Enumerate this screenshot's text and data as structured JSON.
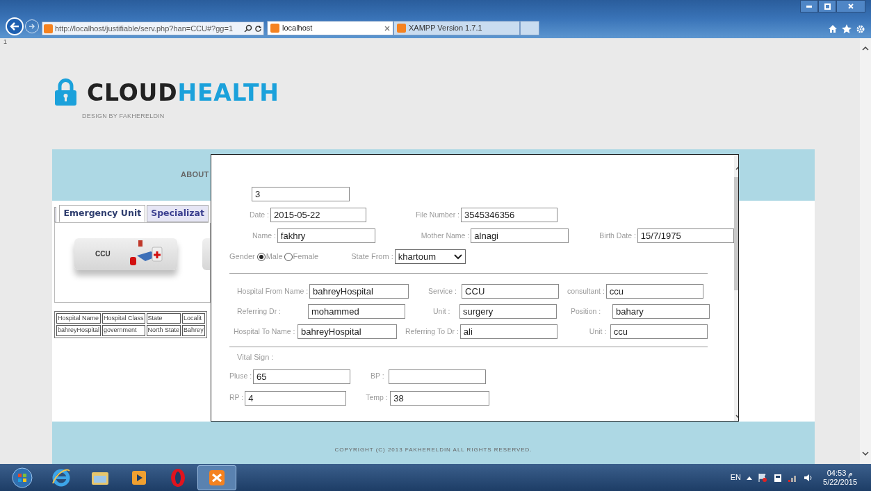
{
  "browser": {
    "address": "http://localhost/justifiable/serv.php?han=CCU#?gg=1",
    "tabs": [
      {
        "label": "localhost",
        "selected": true
      },
      {
        "label": "XAMPP Version 1.7.1",
        "selected": false
      }
    ]
  },
  "corner_text": "1",
  "logo": {
    "word_dark": "CLOUD",
    "word_accent": "HEALTH",
    "tagline": "DESIGN BY FAKHERELDIN"
  },
  "nav": [
    "ABOUT"
  ],
  "unit_tabs": [
    {
      "label": "Emergency Unit",
      "selected": true
    },
    {
      "label": "Specializat",
      "selected": false
    }
  ],
  "unit_buttons": [
    {
      "label": "CCU"
    }
  ],
  "hospital_table": {
    "columns": [
      "Hospital Name",
      "Hospital Class",
      "State",
      "Localit"
    ],
    "rows": [
      [
        "bahreyHospital",
        "government",
        "North State",
        "Bahrey"
      ]
    ]
  },
  "footer": "COPYRIGHT (C) 2013 FAKHERELDIN ALL RIGHTS RESERVED.",
  "form": {
    "top_rows": [
      [
        {
          "value": "3"
        }
      ],
      [
        {
          "label": "Date :",
          "value": "2015-05-22"
        },
        {
          "label": "File Number :",
          "value": "3545346356"
        }
      ],
      [
        {
          "label": "Name :",
          "value": "fakhry"
        },
        {
          "label": "Mother Name :",
          "value": "alnagi"
        },
        {
          "label": "Birth Date :",
          "value": "15/7/1975"
        }
      ]
    ],
    "gender": {
      "label": "Gender",
      "options": [
        {
          "label": "Male",
          "selected": true
        },
        {
          "label": "Female",
          "selected": false
        }
      ]
    },
    "state_from": {
      "label": "State From :",
      "value": "khartoum"
    },
    "referral_rows": [
      [
        {
          "label": "Hospital From Name :",
          "value": "bahreyHospital"
        },
        {
          "label": "Service :",
          "value": "CCU"
        },
        {
          "label": "consultant :",
          "value": "ccu"
        }
      ],
      [
        {
          "label": "Referring Dr :",
          "value": "mohammed"
        },
        {
          "label": "Unit :",
          "value": "surgery"
        },
        {
          "label": "Position :",
          "value": "bahary"
        }
      ],
      [
        {
          "label": "Hospital To Name :",
          "value": "bahreyHospital"
        },
        {
          "label": "Referring To Dr :",
          "value": "ali"
        },
        {
          "label": "Unit :",
          "value": "ccu"
        }
      ]
    ],
    "vital_label": "Vital Sign :",
    "vital_rows": [
      [
        {
          "label": "Pluse :",
          "value": "65"
        },
        {
          "label": "BP :"
        }
      ],
      [
        {
          "label": "RP :",
          "value": "4"
        },
        {
          "label": "Temp :",
          "value": "38"
        }
      ]
    ]
  },
  "taskbar": {
    "language": "EN",
    "time": "04:53 م",
    "date": "5/22/2015"
  }
}
